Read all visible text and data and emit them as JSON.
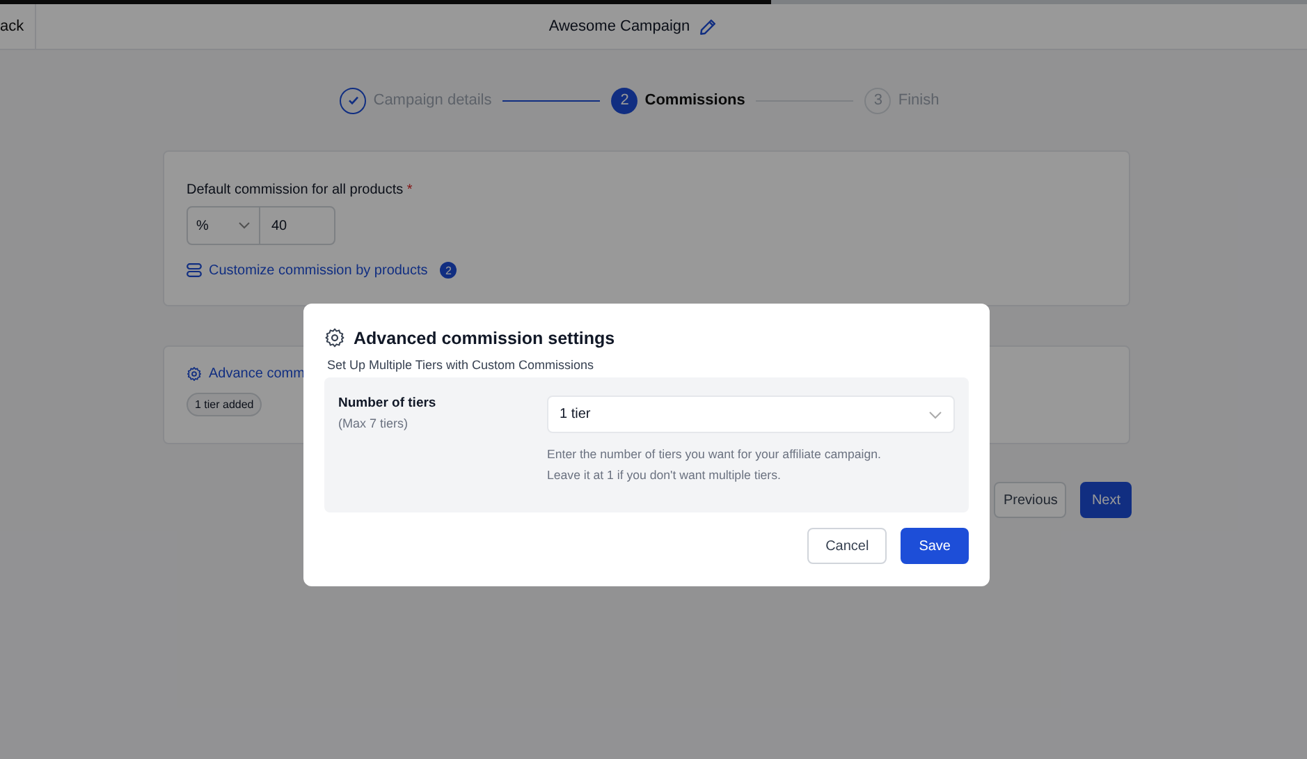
{
  "progress": {
    "level": 0.59
  },
  "topbar": {
    "back": "ack",
    "title": "Awesome Campaign"
  },
  "steps": [
    {
      "label": "Campaign details",
      "completed": true,
      "selected": false
    },
    {
      "label": "Commissions",
      "number": "2",
      "completed": false,
      "selected": true
    },
    {
      "label": "Finish",
      "number": "3",
      "completed": false,
      "selected": false
    }
  ],
  "commission_card": {
    "label": "Default commission for all products",
    "required_mark": "*",
    "unit": "%",
    "value": "40",
    "customize_link": "Customize commission by products",
    "customize_count": "2"
  },
  "advanced_card": {
    "link": "Advance comm",
    "tag": "1 tier added"
  },
  "nav_buttons": [
    {
      "label": "Previous",
      "kind": "secondary"
    },
    {
      "label": "Next",
      "kind": "primary"
    }
  ],
  "modal": {
    "title": "Advanced commission settings",
    "subtitle": "Set Up Multiple Tiers with Custom Commissions",
    "field_label": "Number of tiers",
    "field_hint": "(Max 7 tiers)",
    "field_value": "1 tier",
    "help_lines": [
      "Enter the number of tiers you want for your affiliate campaign.",
      "Leave it at 1 if you don't want multiple tiers."
    ],
    "buttons": [
      {
        "label": "Cancel",
        "kind": "secondary"
      },
      {
        "label": "Save",
        "kind": "primary"
      }
    ]
  }
}
